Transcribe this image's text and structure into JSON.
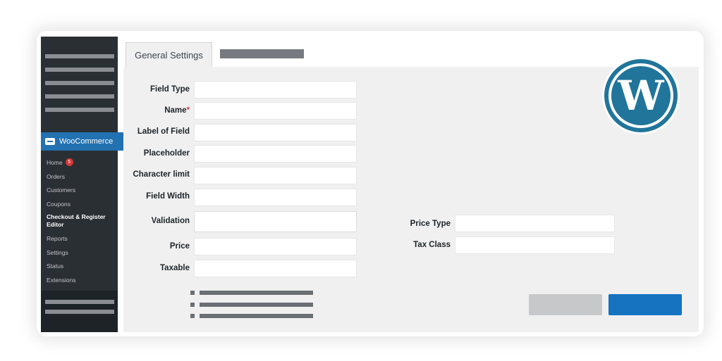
{
  "tabs": [
    {
      "label": "General Settings",
      "active": true
    },
    {
      "label": "",
      "active": false
    }
  ],
  "sidebar": {
    "plugin_label": "WooCommerce",
    "items": [
      {
        "label": "Home",
        "badge": "5"
      },
      {
        "label": "Orders"
      },
      {
        "label": "Customers"
      },
      {
        "label": "Coupons"
      },
      {
        "label": "Checkout & Register Editor",
        "active": true
      },
      {
        "label": "Reports"
      },
      {
        "label": "Settings"
      },
      {
        "label": "Status"
      },
      {
        "label": "Extensions"
      }
    ]
  },
  "form": {
    "field_type": {
      "label": "Field Type",
      "value": ""
    },
    "name": {
      "label": "Name",
      "required_mark": "*",
      "value": ""
    },
    "label_of_field": {
      "label": "Label of Field",
      "value": ""
    },
    "placeholder": {
      "label": "Placeholder",
      "value": ""
    },
    "character_limit": {
      "label": "Character limit",
      "value": ""
    },
    "field_width": {
      "label": "Field Width",
      "value": ""
    },
    "validation": {
      "label": "Validation",
      "value": ""
    },
    "price": {
      "label": "Price",
      "value": ""
    },
    "taxable": {
      "label": "Taxable",
      "value": ""
    },
    "price_type": {
      "label": "Price Type",
      "value": ""
    },
    "tax_class": {
      "label": "Tax Class",
      "value": ""
    }
  },
  "icons": {
    "logo": "wordpress-logo-icon"
  },
  "colors": {
    "sidebar_bg": "#2a2f34",
    "accent": "#2271b1",
    "primary_button": "#1573c0",
    "secondary_button": "#c7c8ca",
    "content_bg": "#f0f0f1",
    "badge": "#d63638"
  }
}
